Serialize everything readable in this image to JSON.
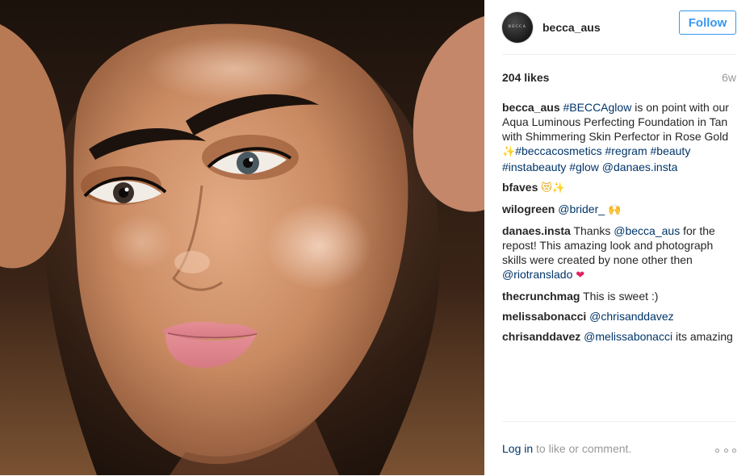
{
  "header": {
    "avatar_text": "BECCA",
    "username": "becca_aus",
    "follow_label": "Follow"
  },
  "stats": {
    "likes": "204 likes",
    "time_ago": "6w"
  },
  "caption": {
    "user": "becca_aus",
    "tag1": "#BECCAglow",
    "text1": " is on point with our Aqua Luminous Perfecting Foundation in Tan with Shimmering Skin Perfector in Rose Gold ",
    "tag2": "#beccacosmetics",
    "tag3": "#regram",
    "tag4": "#beauty",
    "tag5": "#instabeauty",
    "tag6": "#glow",
    "mention": "@danaes.insta"
  },
  "comments": [
    {
      "user": "bfaves"
    },
    {
      "user": "wilogreen",
      "mention": "@brider_"
    },
    {
      "user": "danaes.insta",
      "text1": " Thanks ",
      "mention1": "@becca_aus",
      "text2": " for the repost! This amazing look and photograph skills were created by none other then ",
      "mention2": "@riotranslado"
    },
    {
      "user": "thecrunchmag",
      "text": " This is sweet :)"
    },
    {
      "user": "melissabonacci",
      "mention": "@chrisanddavez"
    },
    {
      "user": "chrisanddavez",
      "mention": "@melissabonacci",
      "text": " its amazing"
    }
  ],
  "footer": {
    "login_label": "Log in",
    "login_suffix": " to like or comment."
  },
  "icons": {
    "sparkles": "sparkles-icon",
    "grin": "heart-eyes-cat-icon",
    "hands": "raised-hands-icon",
    "heart": "red-heart-icon",
    "more": "more-options-icon"
  }
}
